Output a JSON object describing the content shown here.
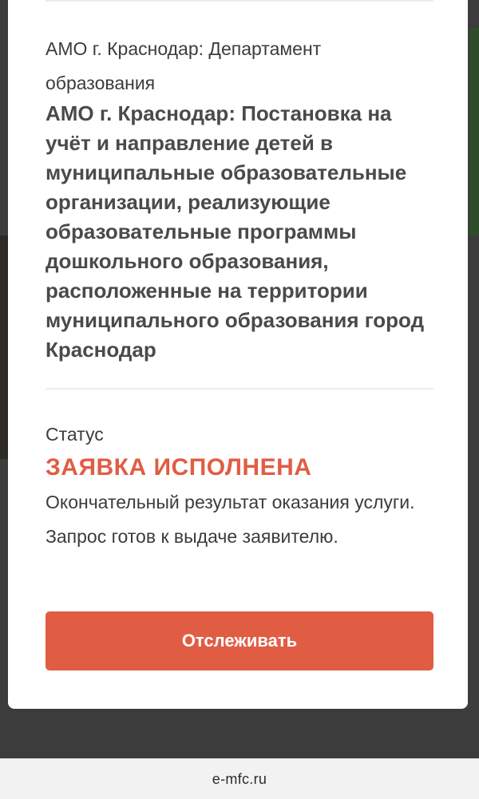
{
  "card": {
    "department": "АМО г. Краснодар: Департамент образования",
    "service_title": "АМО г. Краснодар: Постановка на учёт и направление детей в муниципальные образовательные организации, реализующие образовательные программы дошкольного образования, расположенные на территории муниципального образования город Краснодар",
    "status_label": "Статус",
    "status_value": "ЗАЯВКА ИСПОЛНЕНА",
    "status_description": "Окончательный результат оказания услуги. Запрос готов к выдаче заявителю.",
    "track_button_label": "Отслеживать"
  },
  "browser": {
    "url": "e-mfc.ru"
  },
  "colors": {
    "accent": "#e05d44",
    "card_background": "#ffffff",
    "backdrop": "#3c3c3c"
  }
}
